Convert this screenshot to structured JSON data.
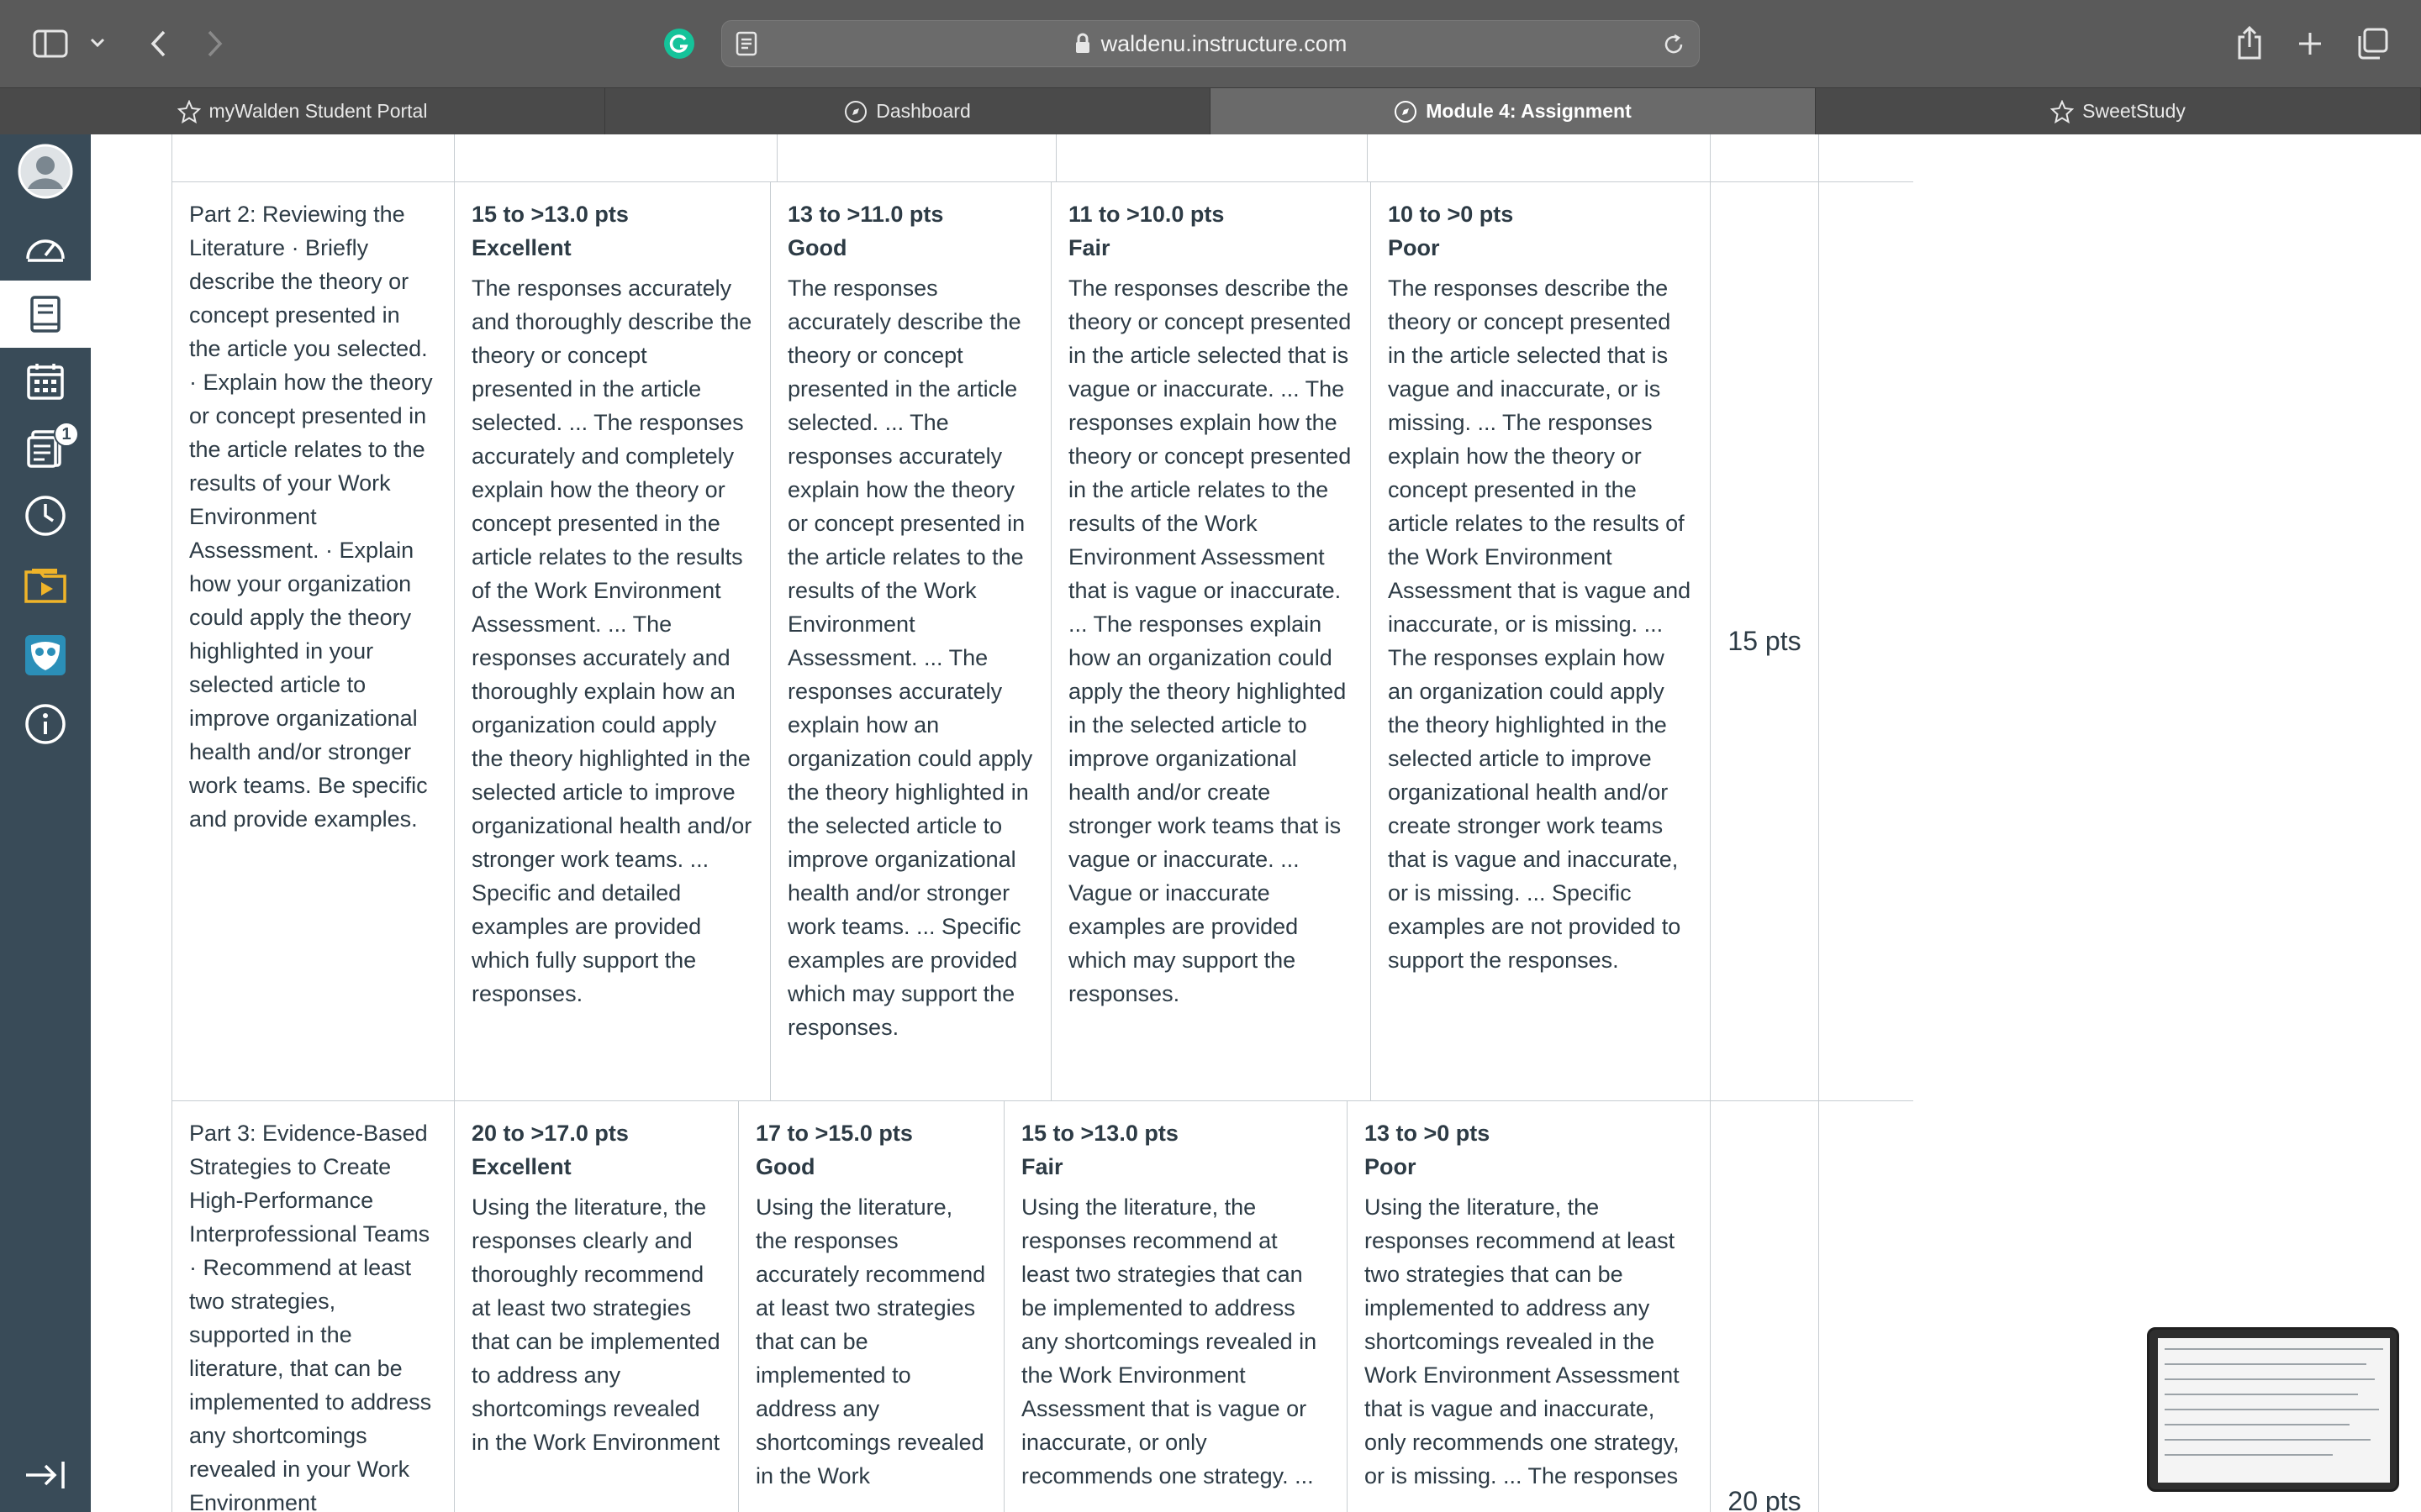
{
  "browser": {
    "url": "waldenu.instructure.com"
  },
  "tabs": [
    {
      "label": "myWalden Student Portal",
      "icon": "star-icon"
    },
    {
      "label": "Dashboard",
      "icon": "compass-icon"
    },
    {
      "label": "Module 4: Assignment",
      "icon": "compass-icon",
      "active": true
    },
    {
      "label": "SweetStudy",
      "icon": "star-icon"
    }
  ],
  "nav": {
    "inbox_badge": "1",
    "items": [
      "account-icon",
      "dashboard-icon",
      "courses-icon",
      "calendar-icon",
      "inbox-icon",
      "history-icon",
      "studio-icon",
      "owl-icon",
      "help-icon",
      "collapse-icon"
    ]
  },
  "rubric": {
    "rows": [
      {
        "criterion": "Part 2: Reviewing the Literature · Briefly describe the theory or concept presented in the article you selected. · Explain how the theory or concept presented in the article relates to the results of your Work Environment Assessment. · Explain how your organization could apply the theory highlighted in your selected article to improve organizational health and/or stronger work teams. Be specific and provide examples.",
        "ratings": [
          {
            "pts": "15 to >13.0 pts",
            "name": "Excellent",
            "desc": "The responses accurately and thoroughly describe the theory or concept presented in the article selected. ... The responses accurately and completely explain how the theory or concept presented in the article relates to the results of the Work Environment Assessment. ... The responses accurately and thoroughly explain how an organization could apply the theory highlighted in the selected article to improve organizational health and/or stronger work teams. ... Specific and detailed examples are provided which fully support the responses."
          },
          {
            "pts": "13 to >11.0 pts",
            "name": "Good",
            "desc": "The responses accurately describe the theory or concept presented in the article selected. ... The responses accurately explain how the theory or concept presented in the article relates to the results of the Work Environment Assessment. ... The responses accurately explain how an organization could apply the theory highlighted in the selected article to improve organizational health and/or stronger work teams. ... Specific examples are provided which may support the responses."
          },
          {
            "pts": "11 to >10.0 pts",
            "name": "Fair",
            "desc": "The responses describe the theory or concept presented in the article selected that is vague or inaccurate. ... The responses explain how the theory or concept presented in the article relates to the results of the Work Environment Assessment that is vague or inaccurate. ... The responses explain how an organization could apply the theory highlighted in the selected article to improve organizational health and/or create stronger work teams that is vague or inaccurate. ... Vague or inaccurate examples are provided which may support the responses."
          },
          {
            "pts": "10 to >0 pts",
            "name": "Poor",
            "desc": "The responses describe the theory or concept presented in the article selected that is vague and inaccurate, or is missing. ... The responses explain how the theory or concept presented in the article relates to the results of the Work Environment Assessment that is vague and inaccurate, or is missing. ... The responses explain how an organization could apply the theory highlighted in the selected article to improve organizational health and/or create stronger work teams that is vague and inaccurate, or is missing. ... Specific examples are not provided to support the responses."
          }
        ],
        "points": "15 pts"
      },
      {
        "criterion": "Part 3: Evidence-Based Strategies to Create High-Performance Interprofessional Teams · Recommend at least two strategies, supported in the literature, that can be implemented to address any shortcomings revealed in your Work Environment",
        "ratings": [
          {
            "pts": "20 to >17.0 pts",
            "name": "Excellent",
            "desc": "Using the literature, the responses clearly and thoroughly recommend at least two strategies that can be implemented to address any shortcomings revealed in the Work Environment"
          },
          {
            "pts": "17 to >15.0 pts",
            "name": "Good",
            "desc": "Using the literature, the responses accurately recommend at least two strategies that can be implemented to address any shortcomings revealed in the Work"
          },
          {
            "pts": "15 to >13.0 pts",
            "name": "Fair",
            "desc": "Using the literature, the responses recommend at least two strategies that can be implemented to address any shortcomings revealed in the Work Environment Assessment that is vague or inaccurate, or only recommends one strategy. ..."
          },
          {
            "pts": "13 to >0 pts",
            "name": "Poor",
            "desc": "Using the literature, the responses recommend at least two strategies that can be implemented to address any shortcomings revealed in the Work Environment Assessment that is vague and inaccurate, only recommends one strategy, or is missing. ... The responses"
          }
        ],
        "points": "20 pts"
      }
    ]
  }
}
